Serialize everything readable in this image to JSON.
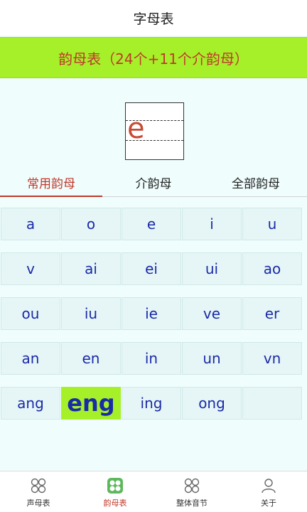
{
  "app": {
    "title": "字母表"
  },
  "banner": {
    "text": "韵母表（24个+11个介韵母）"
  },
  "preview": {
    "letter": "e"
  },
  "tabs": [
    {
      "label": "常用韵母",
      "active": true
    },
    {
      "label": "介韵母",
      "active": false
    },
    {
      "label": "全部韵母",
      "active": false
    }
  ],
  "grid": {
    "rows": [
      [
        "a",
        "o",
        "e",
        "i",
        "u"
      ],
      [
        "v",
        "ai",
        "ei",
        "ui",
        "ao"
      ],
      [
        "ou",
        "iu",
        "ie",
        "ve",
        "er"
      ],
      [
        "an",
        "en",
        "in",
        "un",
        "vn"
      ],
      [
        "ang",
        "eng",
        "ing",
        "ong",
        ""
      ]
    ],
    "selected": "eng"
  },
  "nav": {
    "items": [
      {
        "label": "声母表",
        "icon": "grid-circles-icon",
        "active": false
      },
      {
        "label": "韵母表",
        "icon": "clover-icon",
        "active": true
      },
      {
        "label": "整体音节",
        "icon": "grid-circles-icon",
        "active": false
      },
      {
        "label": "关于",
        "icon": "person-icon",
        "active": false
      }
    ]
  },
  "colors": {
    "accent": "#c0392b",
    "highlight": "#a6f02a",
    "cell_text": "#1a2aa8",
    "active_icon": "#5cb85c"
  }
}
